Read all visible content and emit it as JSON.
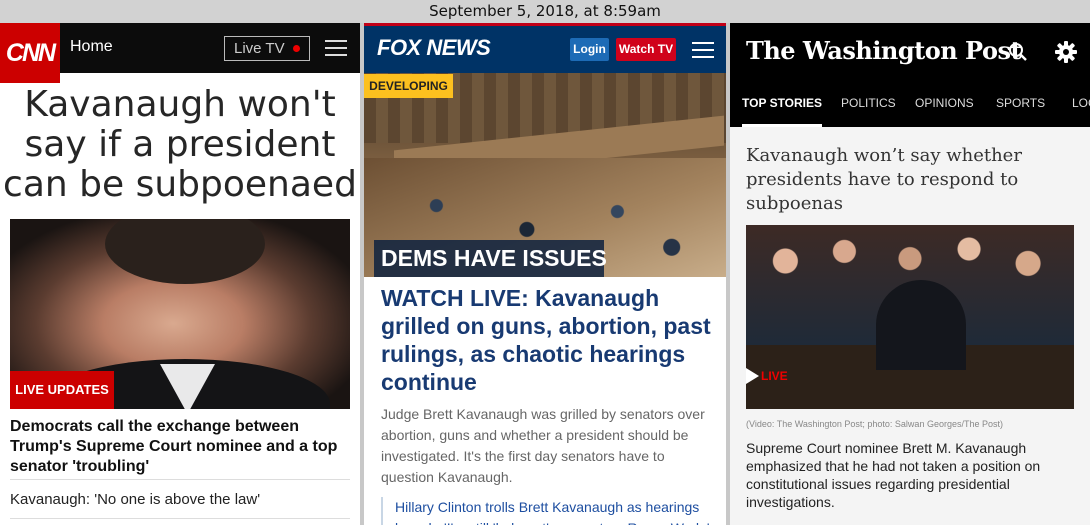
{
  "datebar": "September 5, 2018, at 8:59am",
  "cnn": {
    "logo": "CNN",
    "nav_home": "Home",
    "live_tv": "Live TV",
    "headline": "Kavanaugh won't say if a president can be subpoenaed",
    "badge": "LIVE UPDATES",
    "subheadline": "Democrats call the exchange between Trump's Supreme Court nominee and a top senator 'troubling'",
    "related": "Kavanaugh: 'No one is above the law'"
  },
  "fox": {
    "logo": "FOX NEWS",
    "login": "Login",
    "watch_tv": "Watch TV",
    "developing": "DEVELOPING",
    "photo_caption": "DEMS HAVE ISSUES",
    "headline": "WATCH LIVE: Kavanaugh grilled on guns, abortion, past rulings, as chaotic hearings continue",
    "summary": "Judge Brett Kavanaugh was grilled by senators over abortion, guns and whether a president should be investigated. It's the first day senators have to question Kavanaugh.",
    "related": "Hillary Clinton trolls Brett Kavanaugh as hearings launch: 'I'm still 'hole-out' on overturn Roe v. Wade'"
  },
  "wapo": {
    "logo": "The Washington Post",
    "tabs": [
      "TOP STORIES",
      "POLITICS",
      "OPINIONS",
      "SPORTS",
      "LOCAL"
    ],
    "headline": "Kavanaugh won’t say whether presidents have to respond to subpoenas",
    "live": "LIVE",
    "credit": "(Video: The Washington Post; photo: Salwan Georges/The Post)",
    "blurb": "Supreme Court nominee Brett M. Kavanaugh emphasized that he had not taken a position on constitutional issues regarding presidential investigations."
  }
}
